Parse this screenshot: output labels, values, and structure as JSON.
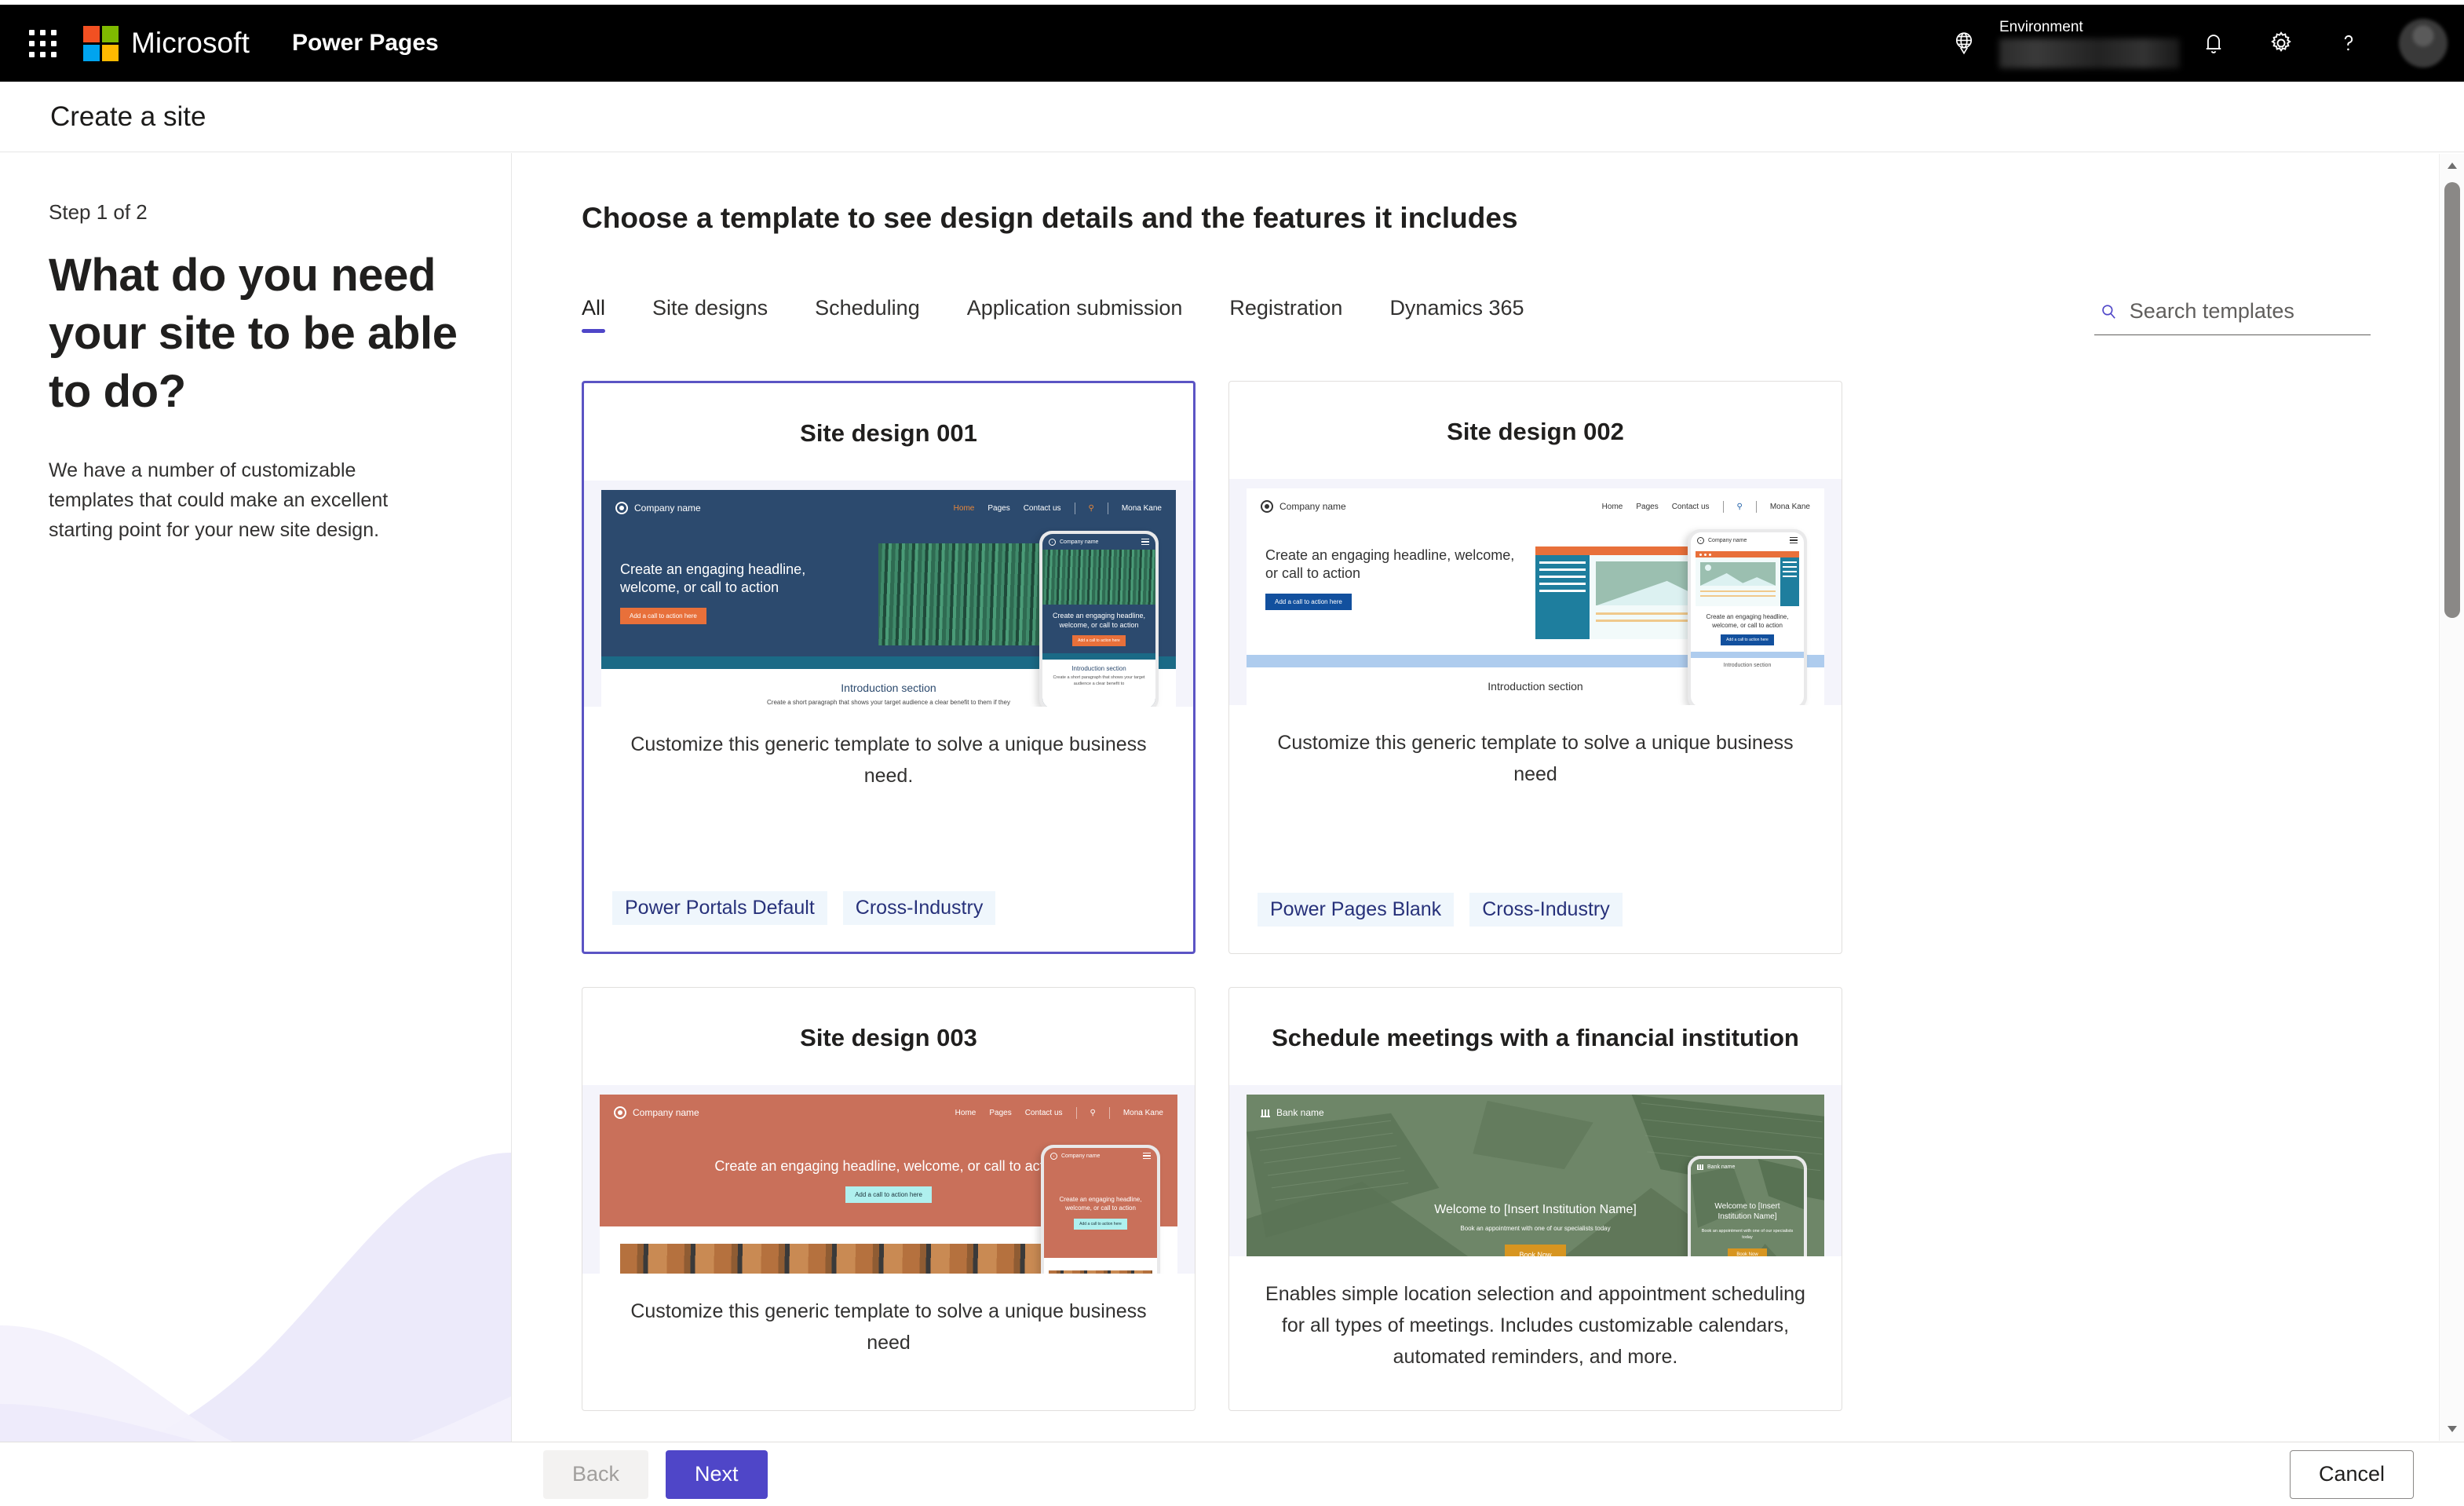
{
  "suite": {
    "waffle_name": "app-launcher-icon",
    "brand": "Microsoft",
    "app_name": "Power Pages",
    "environment_label": "Environment",
    "environment_value": "",
    "globe_title": "Environment region",
    "notifications_title": "Notifications",
    "settings_title": "Settings",
    "help_title": "Help",
    "avatar_title": "Account manager"
  },
  "page": {
    "title": "Create a site"
  },
  "left_panel": {
    "step": "Step 1 of 2",
    "question": "What do you need your site to be able to do?",
    "description": "We have a number of customizable templates that could make an excellent starting point for your new site design."
  },
  "main": {
    "heading": "Choose a template to see design details and the features it includes",
    "tabs": [
      {
        "label": "All",
        "active": true
      },
      {
        "label": "Site designs",
        "active": false
      },
      {
        "label": "Scheduling",
        "active": false
      },
      {
        "label": "Application submission",
        "active": false
      },
      {
        "label": "Registration",
        "active": false
      },
      {
        "label": "Dynamics 365",
        "active": false
      }
    ],
    "search": {
      "placeholder": "Search templates",
      "value": "",
      "icon": "search-icon"
    }
  },
  "cards": [
    {
      "title": "Site design 001",
      "description": "Customize this generic template to solve a unique business need.",
      "tags": [
        "Power Portals Default",
        "Cross-Industry"
      ],
      "selected": true,
      "preview": {
        "brand": "Company name",
        "nav": [
          "Home",
          "Pages",
          "Contact us"
        ],
        "user": "Mona Kane",
        "headline": "Create an engaging headline, welcome, or call to action",
        "cta": "Add a call to action here",
        "intro_title": "Introduction section",
        "intro_text": "Create a short paragraph that shows your target audience a clear benefit to them if they",
        "phone_intro_text": "Create a short paragraph that shows your target audience a clear benefit to"
      }
    },
    {
      "title": "Site design 002",
      "description": "Customize this generic template to solve a unique business need",
      "tags": [
        "Power Pages Blank",
        "Cross-Industry"
      ],
      "selected": false,
      "preview": {
        "brand": "Company name",
        "nav": [
          "Home",
          "Pages",
          "Contact us"
        ],
        "user": "Mona Kane",
        "headline": "Create an engaging headline, welcome, or call to action",
        "cta": "Add a call to action here",
        "intro_title": "Introduction section"
      }
    },
    {
      "title": "Site design 003",
      "description": "Customize this generic template to solve a unique business need",
      "tags": [],
      "selected": false,
      "preview": {
        "brand": "Company name",
        "nav": [
          "Home",
          "Pages",
          "Contact us"
        ],
        "user": "Mona Kane",
        "headline": "Create an engaging headline, welcome, or call to action",
        "cta": "Add a call to action here"
      }
    },
    {
      "title": "Schedule meetings with a financial institution",
      "description": "Enables simple location selection and appointment scheduling for all types of meetings. Includes customizable calendars, automated reminders, and more.",
      "tags": [],
      "selected": false,
      "preview": {
        "brand": "Bank name",
        "headline": "Welcome to [Insert Institution Name]",
        "subhead": "Book an appointment with one of our specialists today",
        "cta": "Book Now",
        "phone_headline": "Welcome to [Insert Institution Name]",
        "phone_subhead": "Book an appointment with one of our specialists today"
      }
    }
  ],
  "footer": {
    "back": "Back",
    "next": "Next",
    "cancel": "Cancel"
  },
  "colors": {
    "accent_purple": "#4F46C8",
    "selected_border": "#5B54C4",
    "tag_bg": "#EFF6FC",
    "tag_text": "#27317a",
    "suite_bar": "#000000"
  }
}
